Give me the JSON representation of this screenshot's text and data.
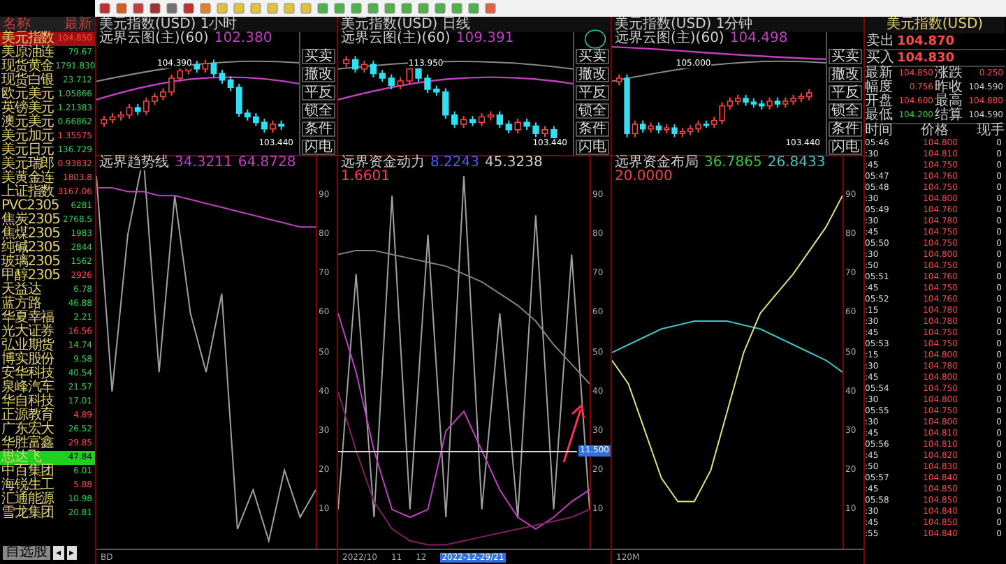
{
  "sidebar": {
    "columns": [
      "名称",
      "最新"
    ],
    "rows": [
      {
        "name": "美元指数",
        "value": "104.850",
        "color": "#ff4848",
        "selected": true,
        "flash": false
      },
      {
        "name": "美原油连",
        "value": "79.67",
        "color": "#30d050",
        "selected": false,
        "flash": false
      },
      {
        "name": "现货黄金",
        "value": "1791.830",
        "color": "#30d050",
        "selected": false,
        "flash": false
      },
      {
        "name": "现货白银",
        "value": "23.712",
        "color": "#30d050",
        "selected": false,
        "flash": false
      },
      {
        "name": "欧元美元",
        "value": "1.05866",
        "color": "#30d050",
        "selected": false,
        "flash": false
      },
      {
        "name": "英镑美元",
        "value": "1.21383",
        "color": "#30d050",
        "selected": false,
        "flash": false
      },
      {
        "name": "澳元美元",
        "value": "0.66862",
        "color": "#30d050",
        "selected": false,
        "flash": false
      },
      {
        "name": "美元加元",
        "value": "1.35575",
        "color": "#ff4848",
        "selected": false,
        "flash": false
      },
      {
        "name": "美元日元",
        "value": "136.729",
        "color": "#30d050",
        "selected": false,
        "flash": false
      },
      {
        "name": "美元瑞郎",
        "value": "0.93832",
        "color": "#ff4848",
        "selected": false,
        "flash": false
      },
      {
        "name": "美黄金连",
        "value": "1803.8",
        "color": "#ff4848",
        "selected": false,
        "flash": false
      },
      {
        "name": "上证指数",
        "value": "3167.06",
        "color": "#ff4848",
        "selected": false,
        "flash": false
      },
      {
        "name": "PVC2305",
        "value": "6281",
        "color": "#30d050",
        "selected": false,
        "flash": false
      },
      {
        "name": "焦炭2305",
        "value": "2768.5",
        "color": "#30d050",
        "selected": false,
        "flash": false
      },
      {
        "name": "焦煤2305",
        "value": "1983",
        "color": "#30d050",
        "selected": false,
        "flash": false
      },
      {
        "name": "纯碱2305",
        "value": "2844",
        "color": "#30d050",
        "selected": false,
        "flash": false
      },
      {
        "name": "玻璃2305",
        "value": "1562",
        "color": "#30d050",
        "selected": false,
        "flash": false
      },
      {
        "name": "甲醇2305",
        "value": "2926",
        "color": "#ff4848",
        "selected": false,
        "flash": false
      },
      {
        "name": "天益达",
        "value": "6.78",
        "color": "#30d050",
        "selected": false,
        "flash": false
      },
      {
        "name": "蓝方路",
        "value": "46.88",
        "color": "#30d050",
        "selected": false,
        "flash": false
      },
      {
        "name": "华夏幸福",
        "value": "2.21",
        "color": "#30d050",
        "selected": false,
        "flash": false
      },
      {
        "name": "光大证券",
        "value": "16.56",
        "color": "#ff4848",
        "selected": false,
        "flash": false
      },
      {
        "name": "弘业期货",
        "value": "14.74",
        "color": "#30d050",
        "selected": false,
        "flash": false
      },
      {
        "name": "博实股份",
        "value": "9.58",
        "color": "#30d050",
        "selected": false,
        "flash": false
      },
      {
        "name": "安华科技",
        "value": "40.54",
        "color": "#30d050",
        "selected": false,
        "flash": false
      },
      {
        "name": "泉峰汽车",
        "value": "21.57",
        "color": "#30d050",
        "selected": false,
        "flash": false
      },
      {
        "name": "华自科技",
        "value": "17.01",
        "color": "#30d050",
        "selected": false,
        "flash": false
      },
      {
        "name": "正源教育",
        "value": "4.89",
        "color": "#ff4848",
        "selected": false,
        "flash": false
      },
      {
        "name": "广东宏大",
        "value": "26.52",
        "color": "#30d050",
        "selected": false,
        "flash": false
      },
      {
        "name": "华胜富鑫",
        "value": "29.85",
        "color": "#ff4848",
        "selected": false,
        "flash": false
      },
      {
        "name": "思达飞",
        "value": "47.84",
        "color": "#000000",
        "selected": false,
        "flash": true
      },
      {
        "name": "中百集团",
        "value": "6.01",
        "color": "#30d050",
        "selected": false,
        "flash": false
      },
      {
        "name": "海锐生工",
        "value": "5.88",
        "color": "#ff4848",
        "selected": false,
        "flash": false
      },
      {
        "name": "汇通能源",
        "value": "10.98",
        "color": "#30d050",
        "selected": false,
        "flash": false
      },
      {
        "name": "雪龙集团",
        "value": "20.81",
        "color": "#30d050",
        "selected": false,
        "flash": false
      }
    ],
    "footer_tab": "自选股",
    "pager": [
      "◂",
      "▸"
    ]
  },
  "panels": [
    {
      "kind": "trend",
      "title": "美元指数(USD) 1小时",
      "top_legend": [
        {
          "text": "远界云图(主)(60)",
          "color": "#d0d0d0"
        },
        {
          "text": "102.380",
          "color": "#c040c0"
        }
      ],
      "high_mark": "104.390",
      "low_mark": "103.440",
      "side_buttons": [
        "买卖",
        "撤改",
        "平反",
        "锁全",
        "条件",
        "闪电"
      ],
      "bottom_legend": [
        {
          "text": "远界趋势线",
          "color": "#d0d0d0"
        },
        {
          "text": "34.3211",
          "color": "#c040c0"
        },
        {
          "text": "64.8728",
          "color": "#c040c0"
        }
      ],
      "chart_data": {
        "type": "line",
        "ylim": [
          0,
          100
        ],
        "yticks": [
          90,
          80,
          70,
          60,
          50,
          40,
          30,
          20,
          10
        ],
        "series": [
          {
            "color": "#a0a0a0",
            "values": [
              95,
              40,
              80,
              100,
              45,
              90,
              60,
              45,
              65,
              5,
              15,
              2,
              20,
              8,
              15
            ]
          },
          {
            "color": "#c040c0",
            "values": [
              92,
              92,
              91,
              91,
              90,
              90,
              89,
              88,
              87,
              86,
              85,
              84,
              83,
              82,
              82
            ]
          }
        ]
      },
      "footer": [
        "BD"
      ]
    },
    {
      "kind": "funds",
      "title": "美元指数(USD) 日线",
      "top_legend": [
        {
          "text": "远界云图(主)(60)",
          "color": "#d0d0d0"
        },
        {
          "text": "109.391",
          "color": "#c040c0"
        }
      ],
      "high_mark": "113.950",
      "low_mark": "103.440",
      "side_buttons": [
        "买卖",
        "撤改",
        "平反",
        "锁全",
        "条件",
        "闪电"
      ],
      "bottom_legend": [
        {
          "text": "远界资金动力",
          "color": "#d0d0d0"
        },
        {
          "text": "8.2243",
          "color": "#4060ff"
        },
        {
          "text": "45.3238",
          "color": "#d0d0d0"
        },
        {
          "text": "1.6601",
          "color": "#ff4040"
        }
      ],
      "chart_data": {
        "type": "line",
        "ylim": [
          0,
          100
        ],
        "yticks": [
          90,
          80,
          70,
          60,
          50,
          40,
          30,
          20,
          10
        ],
        "series": [
          {
            "color": "#a0a0a0",
            "values": [
              10,
              70,
              8,
              90,
              10,
              80,
              8,
              95,
              10,
              60,
              8,
              85,
              10,
              75,
              10
            ]
          },
          {
            "color": "#808080",
            "values": [
              75,
              76,
              76,
              75,
              74,
              73,
              72,
              70,
              68,
              65,
              62,
              58,
              52,
              47,
              42
            ]
          },
          {
            "color": "#c040c0",
            "values": [
              60,
              45,
              25,
              10,
              8,
              10,
              30,
              35,
              25,
              15,
              8,
              5,
              8,
              12,
              15
            ]
          },
          {
            "color": "#802060",
            "values": [
              40,
              25,
              12,
              5,
              2,
              1,
              1,
              2,
              3,
              4,
              5,
              6,
              7,
              8,
              10
            ]
          }
        ]
      },
      "cursor_value": "11.500",
      "footer": [
        "2022/10",
        "11",
        "12"
      ],
      "cursor_date": "2022-12-29/21"
    },
    {
      "kind": "layout",
      "title": "美元指数(USD) 1分钟",
      "top_legend": [
        {
          "text": "远界云图(主)(60)",
          "color": "#d0d0d0"
        },
        {
          "text": "104.498",
          "color": "#c040c0"
        }
      ],
      "high_mark": "105.000",
      "low_mark": "103.440",
      "side_buttons": [
        "买卖",
        "撤改",
        "平反",
        "锁全",
        "条件",
        "闪电"
      ],
      "bottom_legend": [
        {
          "text": "远界资金布局",
          "color": "#d0d0d0"
        },
        {
          "text": "36.7865",
          "color": "#40c040"
        },
        {
          "text": "26.8433",
          "color": "#40c0c0"
        },
        {
          "text": "20.0000",
          "color": "#ff4040"
        }
      ],
      "chart_data": {
        "type": "line",
        "ylim": [
          0,
          100
        ],
        "yticks": [
          90,
          80,
          70,
          60,
          50,
          40,
          30,
          20,
          10
        ],
        "series": [
          {
            "color": "#40c0c0",
            "values": [
              50,
              52,
              54,
              56,
              57,
              58,
              58,
              58,
              57,
              56,
              54,
              52,
              50,
              48,
              45
            ]
          },
          {
            "color": "#e0e080",
            "values": [
              48,
              42,
              30,
              18,
              12,
              12,
              20,
              35,
              50,
              60,
              65,
              70,
              76,
              82,
              90
            ]
          }
        ]
      },
      "footer": [
        "120M"
      ]
    }
  ],
  "quote": {
    "title": "美元指数(USD)",
    "sell_label": "卖出",
    "sell": "104.870",
    "buy_label": "买入",
    "buy": "104.830",
    "stats": [
      {
        "label": "最新",
        "value": "104.850",
        "color": "#ff4848"
      },
      {
        "label": "涨跌",
        "value": "0.250",
        "color": "#ff4848"
      },
      {
        "label": "幅度",
        "value": "0.756",
        "color": "#ff4848"
      },
      {
        "label": "昨收",
        "value": "104.590",
        "color": "#d0d0d0"
      },
      {
        "label": "开盘",
        "value": "104.600",
        "color": "#ff4848"
      },
      {
        "label": "最高",
        "value": "104.880",
        "color": "#ff4848"
      },
      {
        "label": "最低",
        "value": "104.200",
        "color": "#30d050"
      },
      {
        "label": "结算",
        "value": "104.590",
        "color": "#d0d0d0"
      }
    ],
    "columns": [
      "时间",
      "价格",
      "现手"
    ],
    "ticks": [
      {
        "time": "05:46",
        "price": "104.800",
        "volume": "0"
      },
      {
        "time": ":30",
        "price": "104.810",
        "volume": "0"
      },
      {
        "time": ":45",
        "price": "104.750",
        "volume": "0"
      },
      {
        "time": "05:47",
        "price": "104.760",
        "volume": "0"
      },
      {
        "time": "05:48",
        "price": "104.750",
        "volume": "0"
      },
      {
        "time": ":30",
        "price": "104.800",
        "volume": "0"
      },
      {
        "time": "05:49",
        "price": "104.760",
        "volume": "0"
      },
      {
        "time": ":30",
        "price": "104.780",
        "volume": "0"
      },
      {
        "time": ":45",
        "price": "104.750",
        "volume": "0"
      },
      {
        "time": "05:50",
        "price": "104.750",
        "volume": "0"
      },
      {
        "time": ":30",
        "price": "104.800",
        "volume": "0"
      },
      {
        "time": ":50",
        "price": "104.750",
        "volume": "0"
      },
      {
        "time": "05:51",
        "price": "104.760",
        "volume": "0"
      },
      {
        "time": ":45",
        "price": "104.750",
        "volume": "0"
      },
      {
        "time": "05:52",
        "price": "104.760",
        "volume": "0"
      },
      {
        "time": ":15",
        "price": "104.780",
        "volume": "0"
      },
      {
        "time": ":30",
        "price": "104.780",
        "volume": "0"
      },
      {
        "time": ":45",
        "price": "104.750",
        "volume": "0"
      },
      {
        "time": "05:53",
        "price": "104.750",
        "volume": "0"
      },
      {
        "time": ":15",
        "price": "104.800",
        "volume": "0"
      },
      {
        "time": ":30",
        "price": "104.780",
        "volume": "0"
      },
      {
        "time": ":45",
        "price": "104.800",
        "volume": "0"
      },
      {
        "time": "05:54",
        "price": "104.750",
        "volume": "0"
      },
      {
        "time": ":30",
        "price": "104.800",
        "volume": "0"
      },
      {
        "time": "05:55",
        "price": "104.750",
        "volume": "0"
      },
      {
        "time": ":30",
        "price": "104.800",
        "volume": "0"
      },
      {
        "time": ":45",
        "price": "104.810",
        "volume": "0"
      },
      {
        "time": "05:56",
        "price": "104.810",
        "volume": "0"
      },
      {
        "time": ":45",
        "price": "104.820",
        "volume": "0"
      },
      {
        "time": ":50",
        "price": "104.830",
        "volume": "0"
      },
      {
        "time": "05:57",
        "price": "104.840",
        "volume": "0"
      },
      {
        "time": ":45",
        "price": "104.850",
        "volume": "0"
      },
      {
        "time": "05:58",
        "price": "104.850",
        "volume": "0"
      },
      {
        "time": ":30",
        "price": "104.840",
        "volume": "0"
      },
      {
        "time": ":45",
        "price": "104.850",
        "volume": "0"
      },
      {
        "time": ":55",
        "price": "104.840",
        "volume": "0"
      }
    ]
  }
}
